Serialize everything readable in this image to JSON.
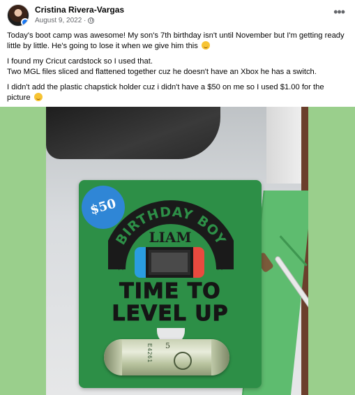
{
  "post": {
    "author": "Cristina Rivera-Vargas",
    "date": "August 9, 2022 ·",
    "privacy_icon": "globe-icon",
    "more_icon": "more-horizontal-icon",
    "more_glyph": "•••",
    "paragraphs": [
      "Today's boot camp was awesome! My son's 7th birthday isn't until November but I'm getting ready little by little. He's going to lose it when we give him this",
      "I found my Cricut cardstock so I used that.",
      "Two MGL files sliced and flattened together cuz he doesn't have an Xbox he has a switch.",
      "I didn't add the plastic chapstick holder cuz i didn't have a $50 on me so I used $1.00 for the picture"
    ]
  },
  "card": {
    "badge": "$50",
    "arc_text": "BIRTHDAY BOY",
    "name": "LIAM",
    "line1": "TIME TO",
    "line2": "LEVEL UP",
    "bill_serial": "E4261",
    "bill_digit": "5"
  },
  "colors": {
    "background_green": "#9acf8c",
    "card_green": "#2d8f47",
    "badge_blue": "#2f86d6",
    "joycon_blue": "#2a9de0",
    "joycon_red": "#e94a3f"
  }
}
